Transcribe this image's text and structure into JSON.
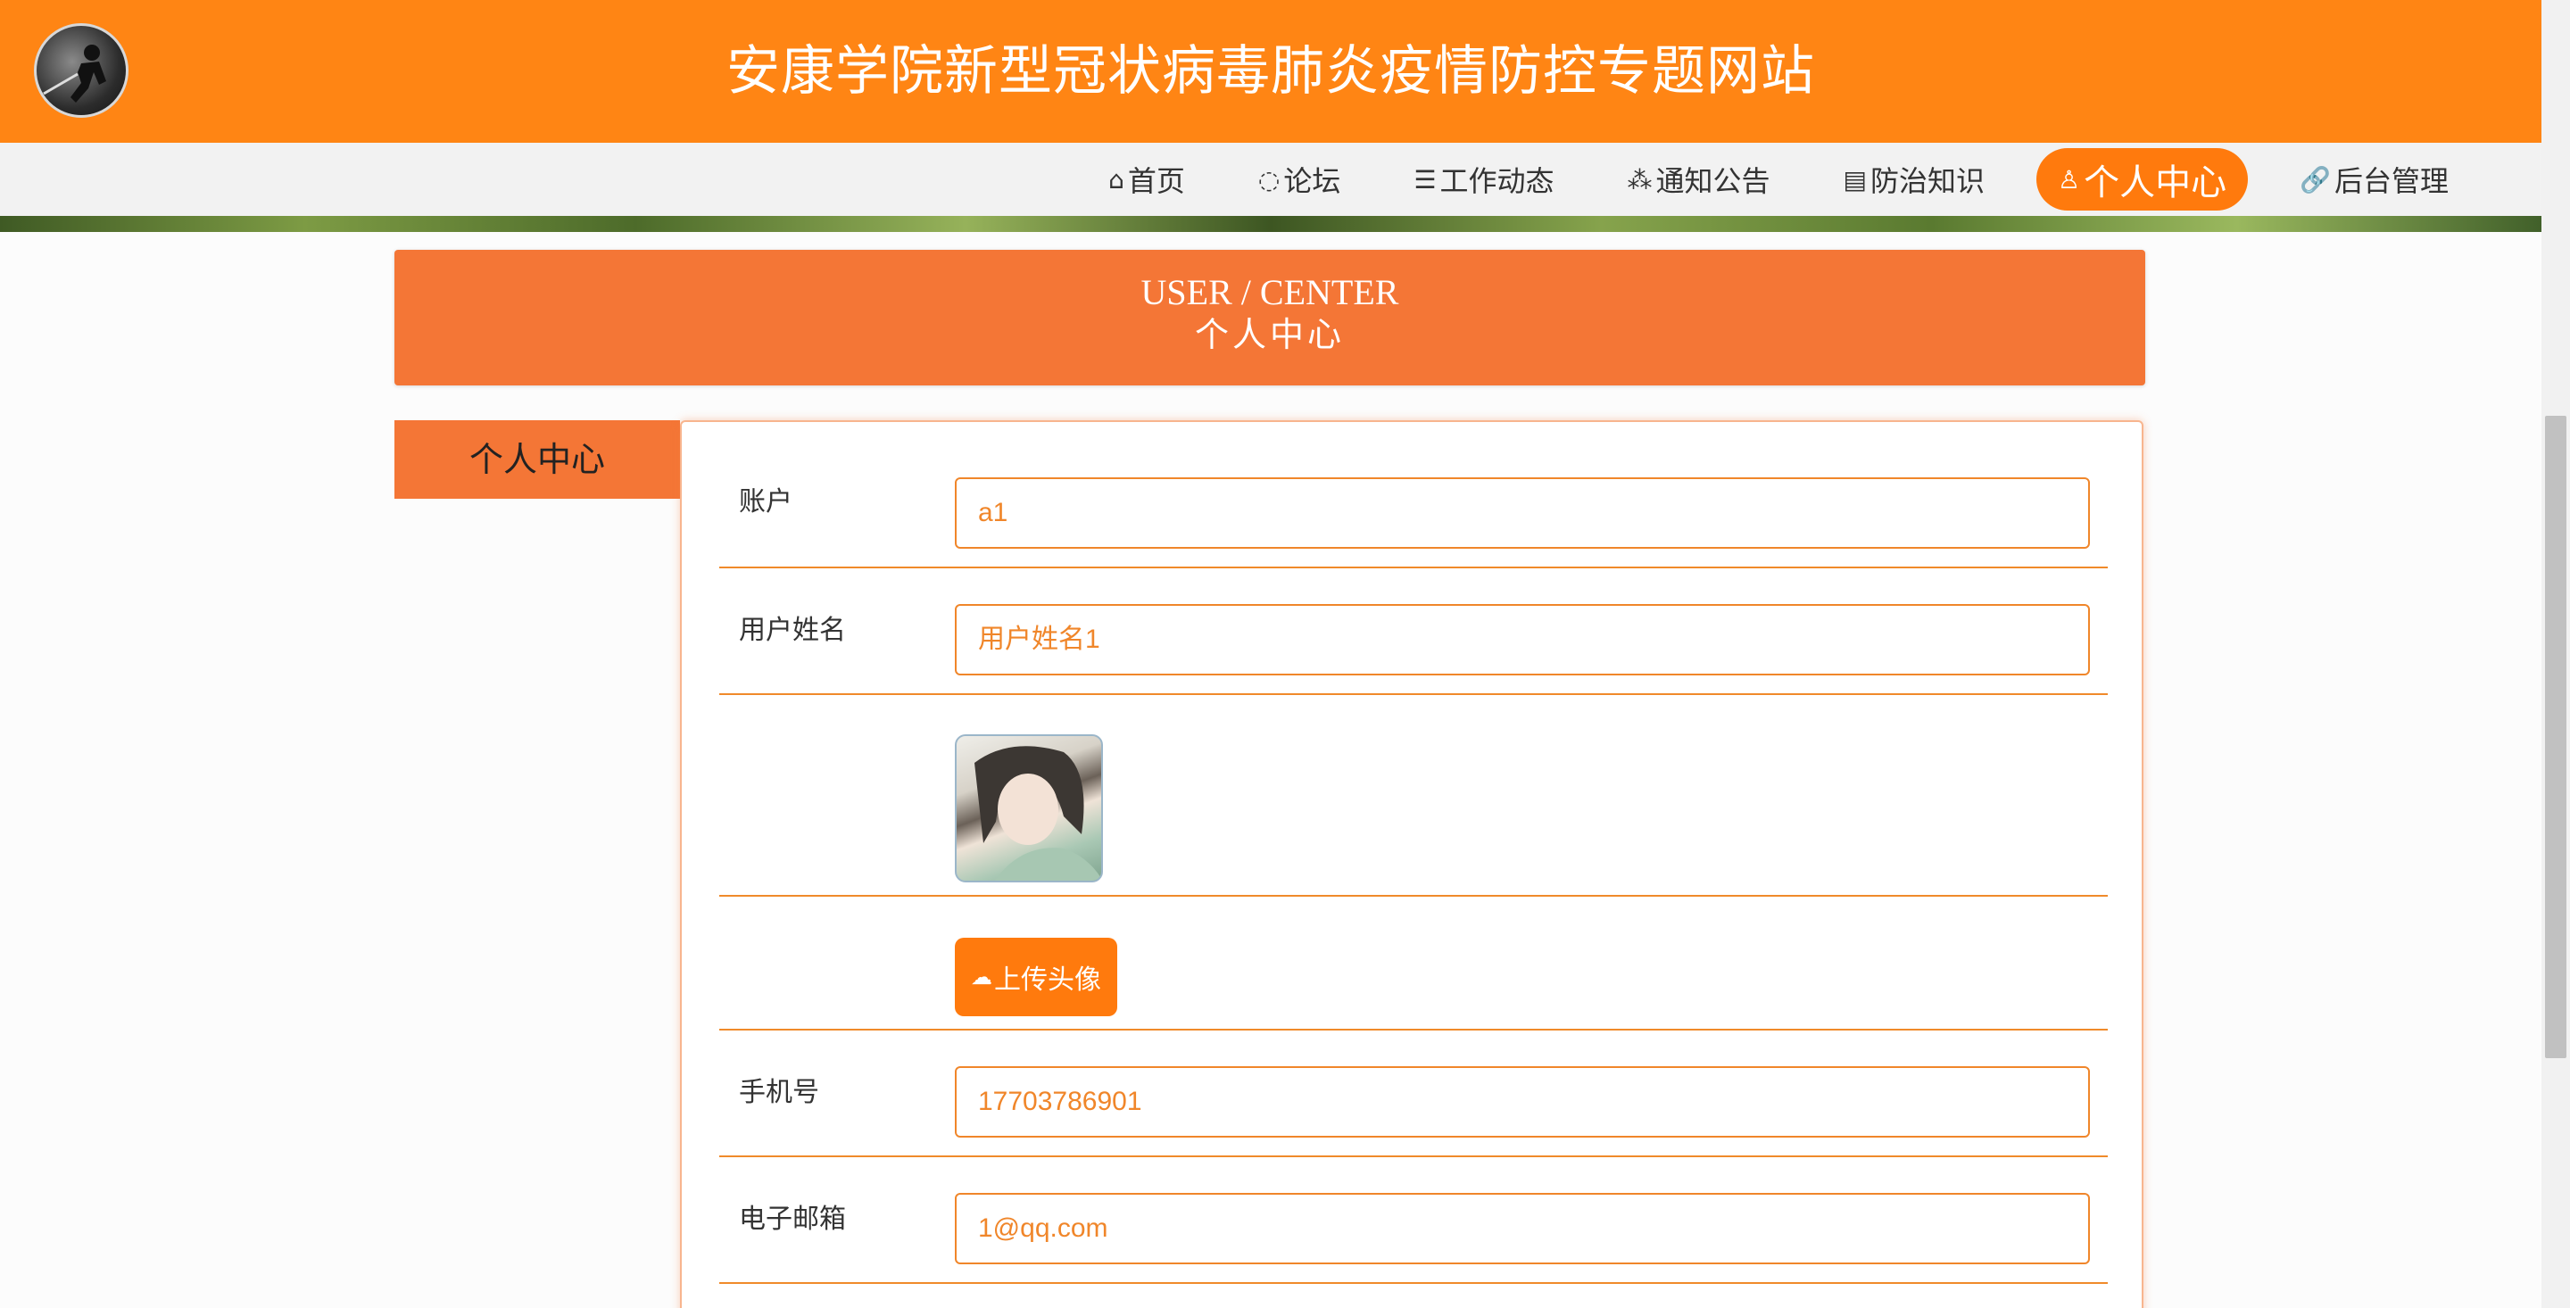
{
  "header": {
    "title": "安康学院新型冠状病毒肺炎疫情防控专题网站",
    "logo_icon": "runner-logo-icon"
  },
  "nav": {
    "items": [
      {
        "label": "首页",
        "icon": "home-icon",
        "glyph": "⌂"
      },
      {
        "label": "论坛",
        "icon": "chat-icon",
        "glyph": "◌"
      },
      {
        "label": "工作动态",
        "icon": "layers-icon",
        "glyph": "☰"
      },
      {
        "label": "通知公告",
        "icon": "bell-icon",
        "glyph": "⁂"
      },
      {
        "label": "防治知识",
        "icon": "document-icon",
        "glyph": "▤"
      },
      {
        "label": "个人中心",
        "icon": "user-icon",
        "glyph": "♙",
        "active": true
      },
      {
        "label": "后台管理",
        "icon": "link-icon",
        "glyph": "🔗"
      }
    ]
  },
  "banner": {
    "en": "USER / CENTER",
    "zh": "个人中心"
  },
  "sidebar": {
    "tab_label": "个人中心"
  },
  "form": {
    "account": {
      "label": "账户",
      "value": "a1"
    },
    "username": {
      "label": "用户姓名",
      "value": "用户姓名1"
    },
    "upload": {
      "label": "上传头像",
      "icon": "cloud-upload-icon"
    },
    "phone": {
      "label": "手机号",
      "value": "17703786901"
    },
    "email": {
      "label": "电子邮箱",
      "value": "1@qq.com"
    }
  },
  "colors": {
    "header": "#ff8514",
    "accent": "#f47636",
    "input_border": "#f0862a"
  }
}
